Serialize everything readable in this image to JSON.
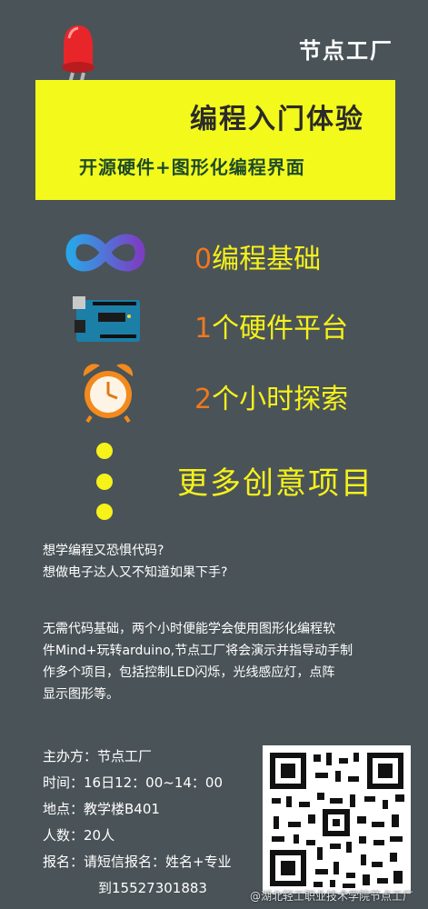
{
  "brand": "节点工厂",
  "banner": {
    "title": "编程入门体验",
    "subtitle": "开源硬件+图形化编程界面"
  },
  "features": [
    {
      "num": "0",
      "text": "编程基础",
      "icon": "infinity-logo-icon"
    },
    {
      "num": "1",
      "text": "个硬件平台",
      "icon": "arduino-board-icon"
    },
    {
      "num": "2",
      "text": "个小时探索",
      "icon": "alarm-clock-icon"
    }
  ],
  "more": "更多创意项目",
  "intro": [
    "想学编程又恐惧代码?",
    "想做电子达人又不知道如果下手?"
  ],
  "description": [
    "无需代码基础，两个小时便能学会使用图形化编程软",
    "件Mind+玩转arduino,节点工厂将会演示并指导动手制",
    "作多个项目，包括控制LED闪烁，光线感应灯，点阵",
    "显示图形等。"
  ],
  "info": {
    "organizer": "主办方：节点工厂",
    "time": "时间：16日12：00~14：00",
    "location": "地点：教学楼B401",
    "count": "人数：20人",
    "signup": "报名：请短信报名：姓名+专业",
    "phone": "到15527301883"
  },
  "watermark": "@湖北轻工职业技术学院节点工厂",
  "colors": {
    "background": "#4a5358",
    "banner": "#f3fa1b",
    "accent_yellow": "#f6f21a",
    "accent_orange": "#f0781d"
  }
}
